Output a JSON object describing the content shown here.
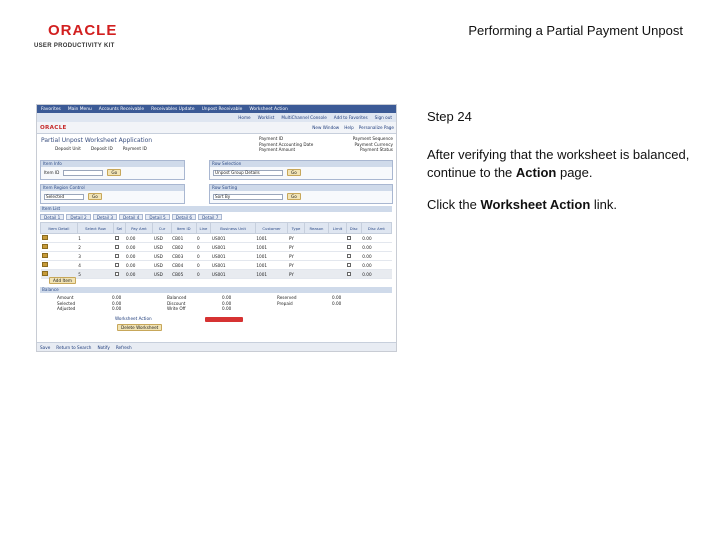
{
  "slide": {
    "logo_word": "ORACLE",
    "logo_sub": "USER PRODUCTIVITY KIT",
    "title": "Performing a Partial Payment Unpost"
  },
  "panel": {
    "step": "Step 24",
    "p1_a": "After verifying that the worksheet is balanced, continue to the ",
    "p1_b": "Action",
    "p1_c": " page.",
    "p2_a": "Click the ",
    "p2_b": "Worksheet Action",
    "p2_c": " link."
  },
  "app": {
    "menu": [
      "Favorites",
      "Main Menu",
      "Accounts Receivable",
      "Receivables Update",
      "Unpost Receivable",
      "Worksheet Action"
    ],
    "menusub": [
      "Home",
      "Worklist",
      "MultiChannel Console",
      "Add to Favorites",
      "Sign out"
    ],
    "oracle": "ORACLE",
    "toplinks": [
      "New Window",
      "Help",
      "Personalize Page"
    ],
    "page_heading": "Partial Unpost Worksheet Application",
    "info_left": [
      "Deposit Unit",
      "Deposit ID",
      "Payment ID"
    ],
    "info_right": [
      [
        "Payment ID",
        "Payment Sequence"
      ],
      [
        "Payment Accounting Date",
        "Payment Currency"
      ],
      [
        "Payment Amount",
        "Payment Status"
      ]
    ],
    "box1": {
      "header": "Item Info",
      "field": "Item ID",
      "btn": "Go"
    },
    "box2": {
      "header": "Row Selection",
      "field": "Unpost Group Details",
      "btn": "Go"
    },
    "box3": {
      "header": "Item Region Control",
      "field": "Selected",
      "btn": "Go"
    },
    "box4": {
      "header": "Row Sorting",
      "field": "Sort By",
      "btn": "Go"
    },
    "lines_header": "Item List",
    "sub_tabs": [
      "Detail 1",
      "Detail 2",
      "Detail 3",
      "Detail 4",
      "Detail 5",
      "Detail 6",
      "Detail 7"
    ],
    "grid_headers": [
      "Item Detail",
      "Select Row",
      "Sel",
      "Pay Amt",
      "Cur",
      "Item ID",
      "Line",
      "Business Unit",
      "Customer",
      "Type",
      "Reason",
      "Limit",
      "Disc",
      "Disc Amt"
    ],
    "grid_rows": [
      [
        "1",
        "0.00",
        "USD",
        "CB01",
        "0",
        "US001",
        "1001",
        "PY",
        "",
        "",
        "0.00"
      ],
      [
        "2",
        "0.00",
        "USD",
        "CB02",
        "0",
        "US001",
        "1001",
        "PY",
        "",
        "",
        "0.00"
      ],
      [
        "3",
        "0.00",
        "USD",
        "CB03",
        "0",
        "US001",
        "1001",
        "PY",
        "",
        "",
        "0.00"
      ],
      [
        "4",
        "0.00",
        "USD",
        "CB04",
        "0",
        "US001",
        "1001",
        "PY",
        "",
        "",
        "0.00"
      ],
      [
        "5",
        "0.00",
        "USD",
        "CB05",
        "0",
        "US001",
        "1001",
        "PY",
        "",
        "",
        "0.00"
      ]
    ],
    "add_btn": "Add Item",
    "balance_header": "Balance",
    "balance_rows": [
      [
        "Amount",
        "0.00",
        "Balanced",
        "0.00",
        "Reserved",
        "0.00"
      ],
      [
        "Selected",
        "0.00",
        "Discount",
        "0.00",
        "Prepaid",
        "0.00"
      ],
      [
        "Adjusted",
        "0.00",
        "Write Off",
        "0.00",
        "",
        ""
      ]
    ],
    "worksheet_action_label": "Worksheet Action",
    "delete_btn": "Delete Worksheet",
    "footer_nav": [
      "Save",
      "Return to Search",
      "Notify",
      "Refresh"
    ]
  },
  "colors": {
    "oracle_red": "#d21f1f",
    "menu_blue": "#3b5a96",
    "highlight_red": "#d63232"
  }
}
